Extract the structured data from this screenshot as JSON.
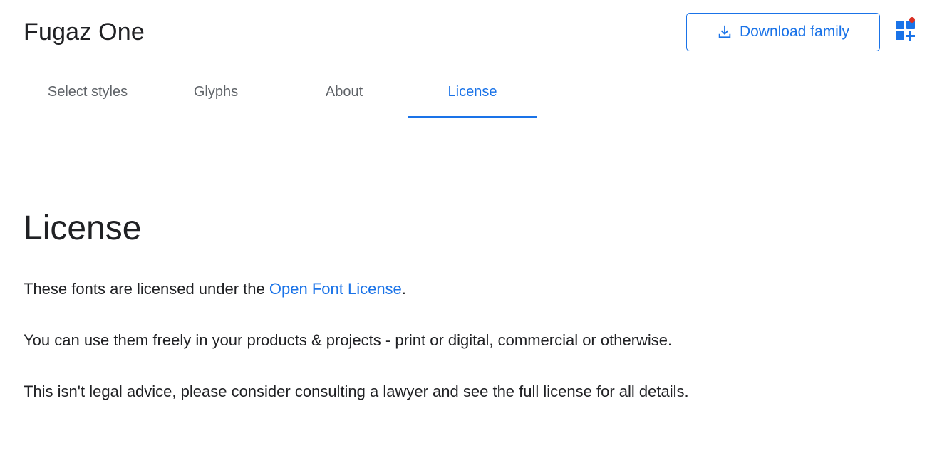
{
  "header": {
    "family_name": "Fugaz One",
    "download_label": "Download family",
    "download_icon": "download-icon",
    "collection_icon": "add-to-collection-icon",
    "accent_color": "#1a73e8",
    "notification_color": "#d93025"
  },
  "tabs": [
    {
      "label": "Select styles",
      "active": false
    },
    {
      "label": "Glyphs",
      "active": false
    },
    {
      "label": "About",
      "active": false
    },
    {
      "label": "License",
      "active": true
    }
  ],
  "license": {
    "heading": "License",
    "p1_prefix": "These fonts are licensed under the ",
    "p1_link": "Open Font License",
    "p1_suffix": ".",
    "p2": "You can use them freely in your products & projects - print or digital, commercial or otherwise.",
    "p3": "This isn't legal advice, please consider consulting a lawyer and see the full license for all details."
  }
}
